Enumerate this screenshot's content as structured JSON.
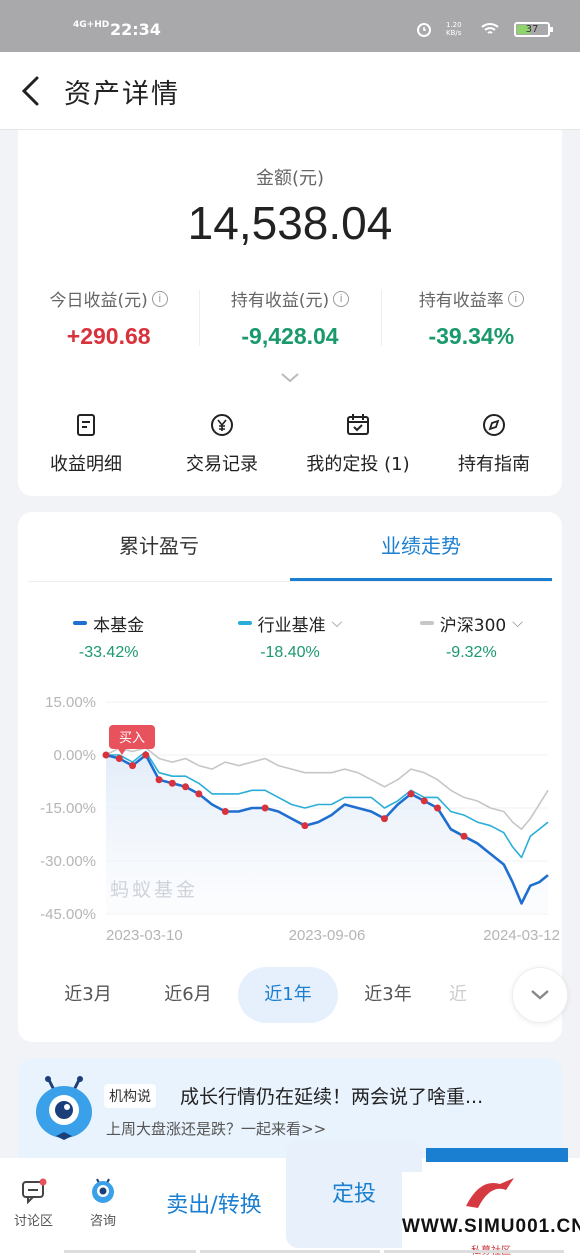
{
  "status_bar": {
    "network": "4G+HD",
    "time": "22:34",
    "speed": "1.20 KB/s",
    "battery": "37"
  },
  "nav": {
    "title": "资产详情"
  },
  "summary": {
    "amount_label": "金额(元)",
    "amount_value": "14,538.04",
    "stats": [
      {
        "label": "今日收益(元)",
        "value": "+290.68",
        "color": "#d8333c"
      },
      {
        "label": "持有收益(元)",
        "value": "-9,428.04",
        "color": "#1a9a6c"
      },
      {
        "label": "持有收益率",
        "value": "-39.34%",
        "color": "#1a9a6c"
      }
    ],
    "actions": [
      {
        "label": "收益明细",
        "icon": "document-icon"
      },
      {
        "label": "交易记录",
        "icon": "yen-icon"
      },
      {
        "label": "我的定投 (1)",
        "icon": "calendar-icon"
      },
      {
        "label": "持有指南",
        "icon": "compass-icon"
      }
    ]
  },
  "performance": {
    "tabs": [
      "累计盈亏",
      "业绩走势"
    ],
    "active_tab": 1,
    "legend": [
      {
        "name": "本基金",
        "value": "-33.42%",
        "color": "#1e6fcf"
      },
      {
        "name": "行业基准",
        "value": "-18.40%",
        "color": "#2aaed8"
      },
      {
        "name": "沪深300",
        "value": "-9.32%",
        "color": "#c6c6c6"
      }
    ],
    "buy_marker": "买入",
    "watermark": "蚂蚁基金",
    "ranges": [
      "近3月",
      "近6月",
      "近1年",
      "近3年",
      "近"
    ],
    "active_range": 2
  },
  "chart_data": {
    "type": "line",
    "x_ticks": [
      "2023-03-10",
      "2023-09-06",
      "2024-03-12"
    ],
    "y_ticks": [
      "15.00%",
      "0.00%",
      "-15.00%",
      "-30.00%",
      "-45.00%"
    ],
    "ylim": [
      -45,
      15
    ],
    "x": [
      0,
      0.03,
      0.06,
      0.09,
      0.12,
      0.15,
      0.18,
      0.21,
      0.24,
      0.27,
      0.3,
      0.33,
      0.36,
      0.39,
      0.42,
      0.45,
      0.48,
      0.51,
      0.54,
      0.57,
      0.6,
      0.63,
      0.66,
      0.69,
      0.72,
      0.75,
      0.78,
      0.81,
      0.84,
      0.87,
      0.9,
      0.92,
      0.94,
      0.96,
      0.98,
      1.0
    ],
    "series": [
      {
        "name": "本基金",
        "color": "#1e6fcf",
        "values": [
          0,
          -1,
          -3,
          0,
          -7,
          -8,
          -9,
          -11,
          -14,
          -16,
          -16,
          -15,
          -15,
          -16,
          -18,
          -20,
          -19,
          -17,
          -14,
          -15,
          -16,
          -18,
          -14,
          -11,
          -13,
          -15,
          -21,
          -23,
          -25,
          -28,
          -31,
          -36,
          -42,
          -37,
          -36,
          -34
        ]
      },
      {
        "name": "行业基准",
        "color": "#2aaed8",
        "values": [
          0,
          0,
          -2,
          1,
          -5,
          -6,
          -6,
          -8,
          -11,
          -11,
          -11,
          -10,
          -10,
          -12,
          -14,
          -15,
          -14,
          -14,
          -12,
          -12,
          -12,
          -15,
          -13,
          -10,
          -12,
          -12,
          -16,
          -17,
          -19,
          -20,
          -22,
          -26,
          -29,
          -23,
          -21,
          -19
        ]
      },
      {
        "name": "沪深300",
        "color": "#c6c6c6",
        "values": [
          0,
          2,
          1,
          2,
          -1,
          -2,
          -1,
          -3,
          -4,
          -2,
          -3,
          -2,
          -1,
          -3,
          -4,
          -5,
          -5,
          -5,
          -4,
          -5,
          -7,
          -9,
          -7,
          -4,
          -5,
          -7,
          -10,
          -12,
          -13,
          -15,
          -16,
          -19,
          -21,
          -18,
          -14,
          -10
        ]
      }
    ],
    "trade_points": [
      0,
      0.03,
      0.06,
      0.09,
      0.12,
      0.15,
      0.18,
      0.21,
      0.27,
      0.36,
      0.45,
      0.63,
      0.69,
      0.72,
      0.75,
      0.81
    ]
  },
  "news": {
    "tag": "机构说",
    "title": "成长行情仍在延续！两会说了啥重...",
    "subtitle": "上周大盘涨还是跌？一起来看>>"
  },
  "bottom_bar": {
    "discuss": "讨论区",
    "consult": "咨询",
    "sell": "卖出/转换",
    "invest": "定投",
    "watermark_url": "WWW.SIMU001.CN",
    "watermark_sub": "私募社区"
  }
}
